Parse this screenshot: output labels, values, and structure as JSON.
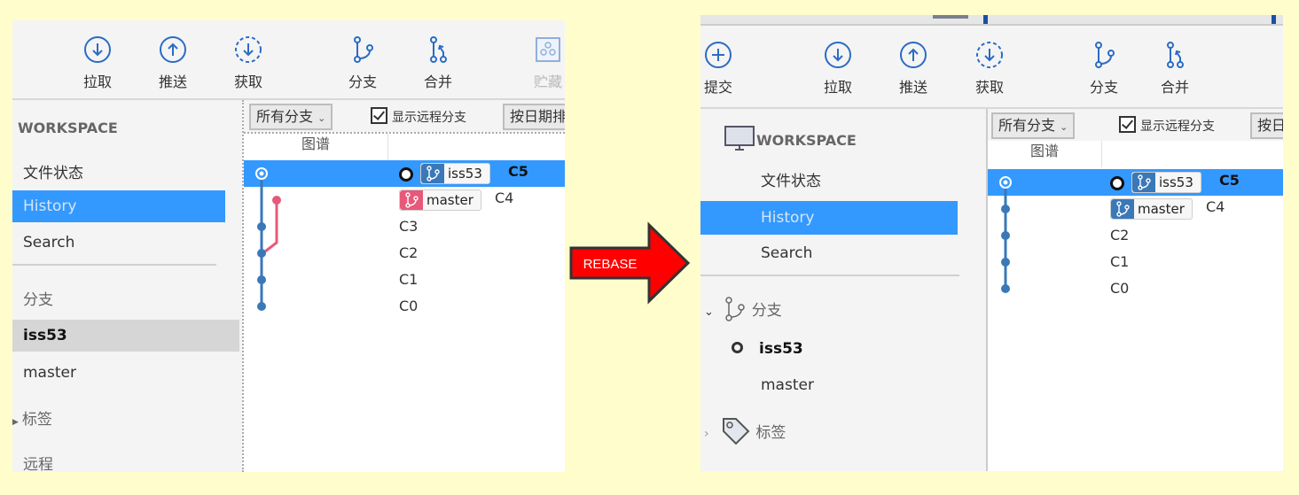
{
  "arrow": {
    "label": "REBASE",
    "fill": "#ff0000"
  },
  "colors": {
    "accent": "#3399ff",
    "branch_blue": "#3a78b8",
    "branch_red": "#e8587a",
    "icon_blue": "#2b6cc4"
  },
  "before": {
    "toolbar": [
      {
        "label": "拉取",
        "icon": "pull-icon"
      },
      {
        "label": "推送",
        "icon": "push-icon"
      },
      {
        "label": "获取",
        "icon": "fetch-icon"
      },
      {
        "label": "分支",
        "icon": "branch-icon"
      },
      {
        "label": "合并",
        "icon": "merge-icon"
      },
      {
        "label": "贮藏",
        "icon": "stash-icon",
        "disabled": true
      }
    ],
    "sidebar": {
      "workspace": "WORKSPACE",
      "items": [
        "文件状态",
        "History",
        "Search"
      ],
      "branches_header": "分支",
      "branches": [
        "iss53",
        "master"
      ],
      "tags_header": "标签",
      "remotes_header": "远程"
    },
    "filter": {
      "branch_select": "所有分支",
      "show_remote": "显示远程分支",
      "sort": "按日期排序"
    },
    "graph_header": "图谱",
    "commits": [
      {
        "refs": [
          {
            "name": "iss53",
            "color": "blue",
            "head": true
          }
        ],
        "message": "C5",
        "bold": true,
        "selected": true
      },
      {
        "refs": [
          {
            "name": "master",
            "color": "red"
          }
        ],
        "message": "C4"
      },
      {
        "refs": [],
        "message": "C3"
      },
      {
        "refs": [],
        "message": "C2"
      },
      {
        "refs": [],
        "message": "C1"
      },
      {
        "refs": [],
        "message": "C0"
      }
    ]
  },
  "after": {
    "toolbar": [
      {
        "label": "提交",
        "icon": "commit-icon"
      },
      {
        "label": "拉取",
        "icon": "pull-icon"
      },
      {
        "label": "推送",
        "icon": "push-icon"
      },
      {
        "label": "获取",
        "icon": "fetch-icon"
      },
      {
        "label": "分支",
        "icon": "branch-icon"
      },
      {
        "label": "合并",
        "icon": "merge-icon"
      }
    ],
    "sidebar": {
      "workspace": "WORKSPACE",
      "items": [
        "文件状态",
        "History",
        "Search"
      ],
      "branches_header": "分支",
      "branches": [
        "iss53",
        "master"
      ],
      "tags_header": "标签"
    },
    "filter": {
      "branch_select": "所有分支",
      "show_remote": "显示远程分支",
      "sort": "按日期排序"
    },
    "graph_header": "图谱",
    "commits": [
      {
        "refs": [
          {
            "name": "iss53",
            "color": "blue",
            "head": true
          }
        ],
        "message": "C5",
        "bold": true,
        "selected": true
      },
      {
        "refs": [
          {
            "name": "master",
            "color": "blue"
          }
        ],
        "message": "C4"
      },
      {
        "refs": [],
        "message": "C2"
      },
      {
        "refs": [],
        "message": "C1"
      },
      {
        "refs": [],
        "message": "C0"
      }
    ]
  }
}
